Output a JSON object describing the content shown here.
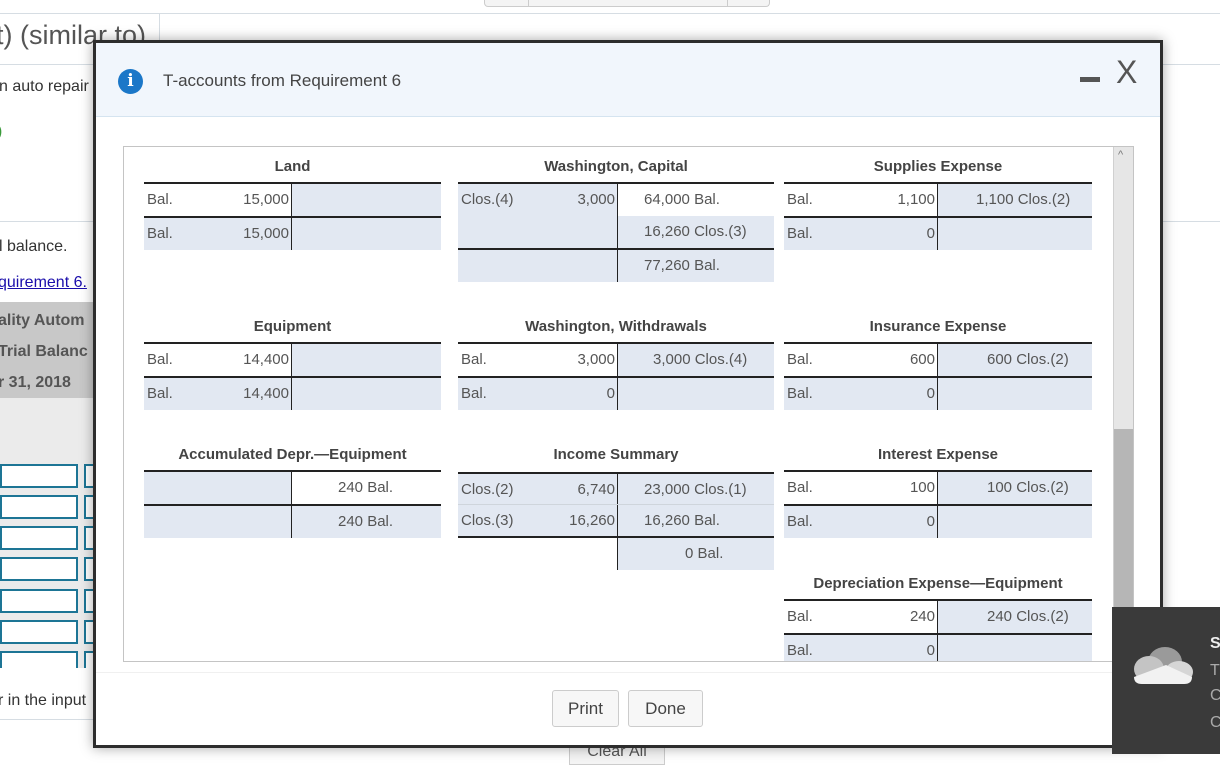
{
  "background": {
    "title_fragment": "t) (similar to)",
    "intro_fragment": "n auto repair",
    "paren_fragment": ")",
    "balance_fragment": "l balance.",
    "link_fragment": "quirement 6.",
    "trial_balance_header": [
      "ality Autom",
      "Trial Balanc",
      "r 31, 2018"
    ],
    "bottom_fragment": "r in the input",
    "clear_all_label": "Clear All"
  },
  "modal": {
    "title": "T-accounts from Requirement 6",
    "icons": {
      "info": "info-icon",
      "minimize": "minimize-icon",
      "close": "close-icon"
    },
    "info_glyph": "i",
    "close_glyph": "X",
    "buttons": {
      "print": "Print",
      "done": "Done"
    }
  },
  "accounts": {
    "land": {
      "title": "Land",
      "rows": [
        {
          "ll": "Bal.",
          "la": "15,000",
          "ra": "",
          "rl": ""
        },
        {
          "ll": "Bal.",
          "la": "15,000",
          "ra": "",
          "rl": ""
        }
      ]
    },
    "capital": {
      "title": "Washington, Capital",
      "rows": [
        {
          "ll": "Clos.(4)",
          "la": "3,000",
          "ra": "64,000",
          "rl": "Bal."
        },
        {
          "ll": "",
          "la": "",
          "ra": "16,260",
          "rl": "Clos.(3)"
        },
        {
          "ll": "",
          "la": "",
          "ra": "77,260",
          "rl": "Bal."
        }
      ]
    },
    "supplies": {
      "title": "Supplies Expense",
      "rows": [
        {
          "ll": "Bal.",
          "la": "1,100",
          "ra": "1,100",
          "rl": "Clos.(2)"
        },
        {
          "ll": "Bal.",
          "la": "0",
          "ra": "",
          "rl": ""
        }
      ]
    },
    "equipment": {
      "title": "Equipment",
      "rows": [
        {
          "ll": "Bal.",
          "la": "14,400",
          "ra": "",
          "rl": ""
        },
        {
          "ll": "Bal.",
          "la": "14,400",
          "ra": "",
          "rl": ""
        }
      ]
    },
    "withdrawals": {
      "title": "Washington, Withdrawals",
      "rows": [
        {
          "ll": "Bal.",
          "la": "3,000",
          "ra": "3,000",
          "rl": "Clos.(4)"
        },
        {
          "ll": "Bal.",
          "la": "0",
          "ra": "",
          "rl": ""
        }
      ]
    },
    "insurance": {
      "title": "Insurance Expense",
      "rows": [
        {
          "ll": "Bal.",
          "la": "600",
          "ra": "600",
          "rl": "Clos.(2)"
        },
        {
          "ll": "Bal.",
          "la": "0",
          "ra": "",
          "rl": ""
        }
      ]
    },
    "accum_depr": {
      "title": "Accumulated Depr.—Equipment",
      "rows": [
        {
          "ll": "",
          "la": "",
          "ra": "240",
          "rl": "Bal."
        },
        {
          "ll": "",
          "la": "",
          "ra": "240",
          "rl": "Bal."
        }
      ]
    },
    "income_summary": {
      "title": "Income Summary",
      "rows": [
        {
          "ll": "Clos.(2)",
          "la": "6,740",
          "ra": "23,000",
          "rl": "Clos.(1)"
        },
        {
          "ll": "Clos.(3)",
          "la": "16,260",
          "ra": "16,260",
          "rl": "Bal."
        },
        {
          "ll": "",
          "la": "",
          "ra": "0",
          "rl": "Bal."
        }
      ]
    },
    "interest": {
      "title": "Interest Expense",
      "rows": [
        {
          "ll": "Bal.",
          "la": "100",
          "ra": "100",
          "rl": "Clos.(2)"
        },
        {
          "ll": "Bal.",
          "la": "0",
          "ra": "",
          "rl": ""
        }
      ]
    },
    "depr_expense": {
      "title": "Depreciation Expense—Equipment",
      "rows": [
        {
          "ll": "Bal.",
          "la": "240",
          "ra": "240",
          "rl": "Clos.(2)"
        },
        {
          "ll": "Bal.",
          "la": "0",
          "ra": "",
          "rl": ""
        }
      ]
    }
  },
  "toast": {
    "icon": "onedrive-cloud-icon",
    "lines": [
      "S",
      "T",
      "C",
      "C"
    ]
  }
}
